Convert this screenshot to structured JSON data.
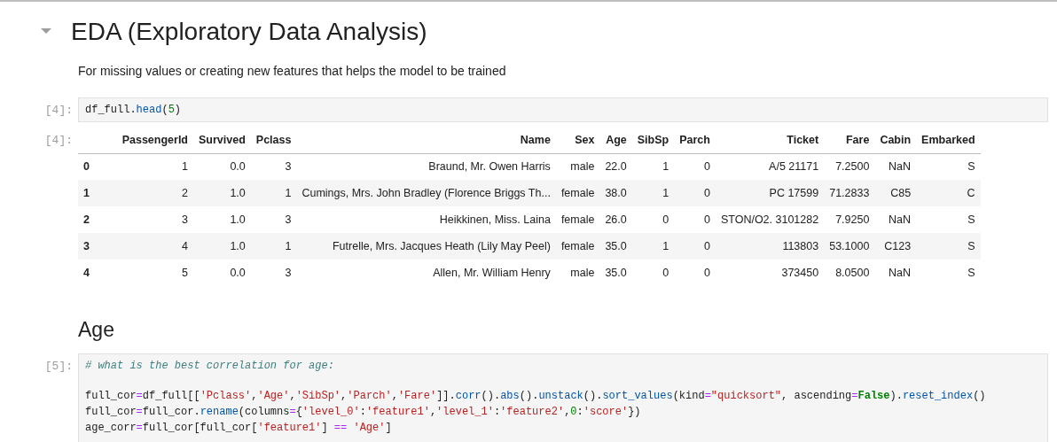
{
  "section": {
    "title": "EDA (Exploratory Data Analysis)",
    "expanded": true
  },
  "description": "For missing values or creating new features that helps the model to be trained",
  "cells": [
    {
      "prompt": "[4]:",
      "lines": [
        [
          {
            "text": "df_full.",
            "kind": "plain"
          },
          {
            "text": "head",
            "kind": "func"
          },
          {
            "text": "(",
            "kind": "plain"
          },
          {
            "text": "5",
            "kind": "number"
          },
          {
            "text": ")",
            "kind": "plain"
          }
        ]
      ]
    }
  ],
  "output": {
    "prompt": "[4]:",
    "columns": [
      "PassengerId",
      "Survived",
      "Pclass",
      "Name",
      "Sex",
      "Age",
      "SibSp",
      "Parch",
      "Ticket",
      "Fare",
      "Cabin",
      "Embarked"
    ],
    "rows": [
      {
        "index": "0",
        "cells": [
          "1",
          "0.0",
          "3",
          "Braund, Mr. Owen Harris",
          "male",
          "22.0",
          "1",
          "0",
          "A/5 21171",
          "7.2500",
          "NaN",
          "S"
        ]
      },
      {
        "index": "1",
        "cells": [
          "2",
          "1.0",
          "1",
          "Cumings, Mrs. John Bradley (Florence Briggs Th...",
          "female",
          "38.0",
          "1",
          "0",
          "PC 17599",
          "71.2833",
          "C85",
          "C"
        ]
      },
      {
        "index": "2",
        "cells": [
          "3",
          "1.0",
          "3",
          "Heikkinen, Miss. Laina",
          "female",
          "26.0",
          "0",
          "0",
          "STON/O2. 3101282",
          "7.9250",
          "NaN",
          "S"
        ]
      },
      {
        "index": "3",
        "cells": [
          "4",
          "1.0",
          "1",
          "Futrelle, Mrs. Jacques Heath (Lily May Peel)",
          "female",
          "35.0",
          "1",
          "0",
          "113803",
          "53.1000",
          "C123",
          "S"
        ]
      },
      {
        "index": "4",
        "cells": [
          "5",
          "0.0",
          "3",
          "Allen, Mr. William Henry",
          "male",
          "35.0",
          "0",
          "0",
          "373450",
          "8.0500",
          "NaN",
          "S"
        ]
      }
    ]
  },
  "subheading": "Age",
  "cell2": {
    "prompt": "[5]:",
    "comment": "# what is the best correlation for age:",
    "lines": [
      [
        {
          "text": "full_cor",
          "kind": "plain"
        },
        {
          "text": "=",
          "kind": "op"
        },
        {
          "text": "df_full[[",
          "kind": "plain"
        },
        {
          "text": "'Pclass'",
          "kind": "string"
        },
        {
          "text": ",",
          "kind": "plain"
        },
        {
          "text": "'Age'",
          "kind": "string"
        },
        {
          "text": ",",
          "kind": "plain"
        },
        {
          "text": "'SibSp'",
          "kind": "string"
        },
        {
          "text": ",",
          "kind": "plain"
        },
        {
          "text": "'Parch'",
          "kind": "string"
        },
        {
          "text": ",",
          "kind": "plain"
        },
        {
          "text": "'Fare'",
          "kind": "string"
        },
        {
          "text": "]].",
          "kind": "plain"
        },
        {
          "text": "corr",
          "kind": "func"
        },
        {
          "text": "().",
          "kind": "plain"
        },
        {
          "text": "abs",
          "kind": "func"
        },
        {
          "text": "().",
          "kind": "plain"
        },
        {
          "text": "unstack",
          "kind": "func"
        },
        {
          "text": "().",
          "kind": "plain"
        },
        {
          "text": "sort_values",
          "kind": "func"
        },
        {
          "text": "(kind",
          "kind": "plain"
        },
        {
          "text": "=",
          "kind": "op"
        },
        {
          "text": "\"quicksort\"",
          "kind": "string"
        },
        {
          "text": ", ascending",
          "kind": "plain"
        },
        {
          "text": "=",
          "kind": "op"
        },
        {
          "text": "False",
          "kind": "keyword"
        },
        {
          "text": ").",
          "kind": "plain"
        },
        {
          "text": "reset_index",
          "kind": "func"
        },
        {
          "text": "()",
          "kind": "plain"
        }
      ],
      [
        {
          "text": "full_cor",
          "kind": "plain"
        },
        {
          "text": "=",
          "kind": "op"
        },
        {
          "text": "full_cor.",
          "kind": "plain"
        },
        {
          "text": "rename",
          "kind": "func"
        },
        {
          "text": "(columns",
          "kind": "plain"
        },
        {
          "text": "=",
          "kind": "op"
        },
        {
          "text": "{",
          "kind": "plain"
        },
        {
          "text": "'level_0'",
          "kind": "string"
        },
        {
          "text": ":",
          "kind": "plain"
        },
        {
          "text": "'feature1'",
          "kind": "string"
        },
        {
          "text": ",",
          "kind": "plain"
        },
        {
          "text": "'level_1'",
          "kind": "string"
        },
        {
          "text": ":",
          "kind": "plain"
        },
        {
          "text": "'feature2'",
          "kind": "string"
        },
        {
          "text": ",",
          "kind": "plain"
        },
        {
          "text": "0",
          "kind": "number"
        },
        {
          "text": ":",
          "kind": "plain"
        },
        {
          "text": "'score'",
          "kind": "string"
        },
        {
          "text": "})",
          "kind": "plain"
        }
      ],
      [
        {
          "text": "age_corr",
          "kind": "plain"
        },
        {
          "text": "=",
          "kind": "op"
        },
        {
          "text": "full_cor[full_cor[",
          "kind": "plain"
        },
        {
          "text": "'feature1'",
          "kind": "string"
        },
        {
          "text": "] ",
          "kind": "plain"
        },
        {
          "text": "== ",
          "kind": "op"
        },
        {
          "text": "'Age'",
          "kind": "string"
        },
        {
          "text": "]",
          "kind": "plain"
        }
      ]
    ]
  }
}
